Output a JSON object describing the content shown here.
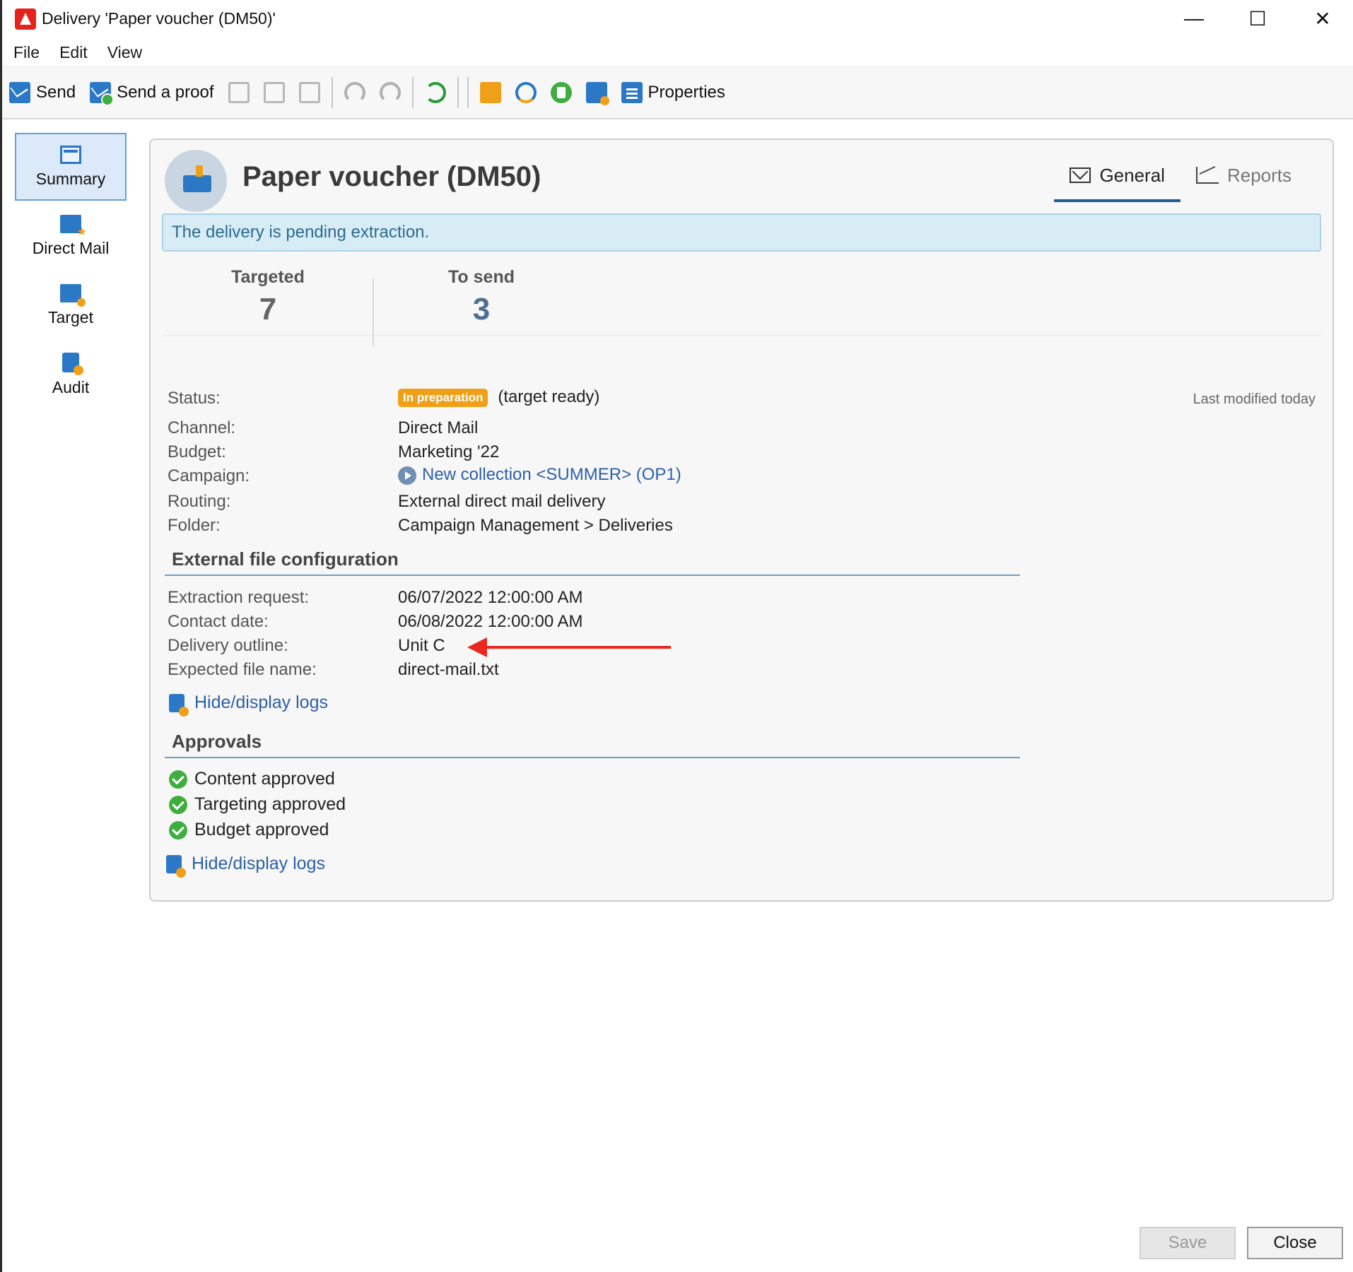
{
  "window": {
    "title": "Delivery 'Paper voucher (DM50)'",
    "minimize_icon": "—",
    "maximize_icon": "☐",
    "close_icon": "✕"
  },
  "menu": [
    "File",
    "Edit",
    "View"
  ],
  "toolbar": {
    "send_label": "Send",
    "send_proof_label": "Send a proof",
    "properties_label": "Properties"
  },
  "nav": [
    "Summary",
    "Direct Mail",
    "Target",
    "Audit"
  ],
  "header": {
    "title": "Paper voucher (DM50)",
    "tabs": [
      "General",
      "Reports"
    ]
  },
  "banner": "The delivery is pending extraction.",
  "stats": [
    {
      "label": "Targeted",
      "value": "7"
    },
    {
      "label": "To send",
      "value": "3"
    }
  ],
  "details": {
    "status_label": "Status:",
    "status_badge": "In preparation",
    "status_note": "(target ready)",
    "last_modified": "Last modified today",
    "channel_label": "Channel:",
    "channel_value": "Direct Mail",
    "budget_label": "Budget:",
    "budget_value": "Marketing '22",
    "campaign_label": "Campaign:",
    "campaign_value": "New collection <SUMMER> (OP1)",
    "routing_label": "Routing:",
    "routing_value": "External direct mail delivery",
    "folder_label": "Folder:",
    "folder_value": "Campaign Management > Deliveries"
  },
  "external": {
    "title": "External file configuration",
    "extraction_label": "Extraction request:",
    "extraction_value": "06/07/2022 12:00:00 AM",
    "contact_label": "Contact date:",
    "contact_value": "06/08/2022 12:00:00 AM",
    "outline_label": "Delivery outline:",
    "outline_value": "Unit C",
    "filename_label": "Expected file name:",
    "filename_value": "direct-mail.txt",
    "logs_link": "Hide/display logs"
  },
  "approvals": {
    "title": "Approvals",
    "items": [
      "Content approved",
      "Targeting approved",
      "Budget approved"
    ],
    "logs_link": "Hide/display logs"
  },
  "buttons": {
    "save": "Save",
    "close": "Close"
  },
  "colors": {
    "accent": "#2a78c6",
    "badge": "#f0a018",
    "banner": "#d8ecf6",
    "arrow": "#e8281e",
    "approved": "#3fae3f"
  }
}
